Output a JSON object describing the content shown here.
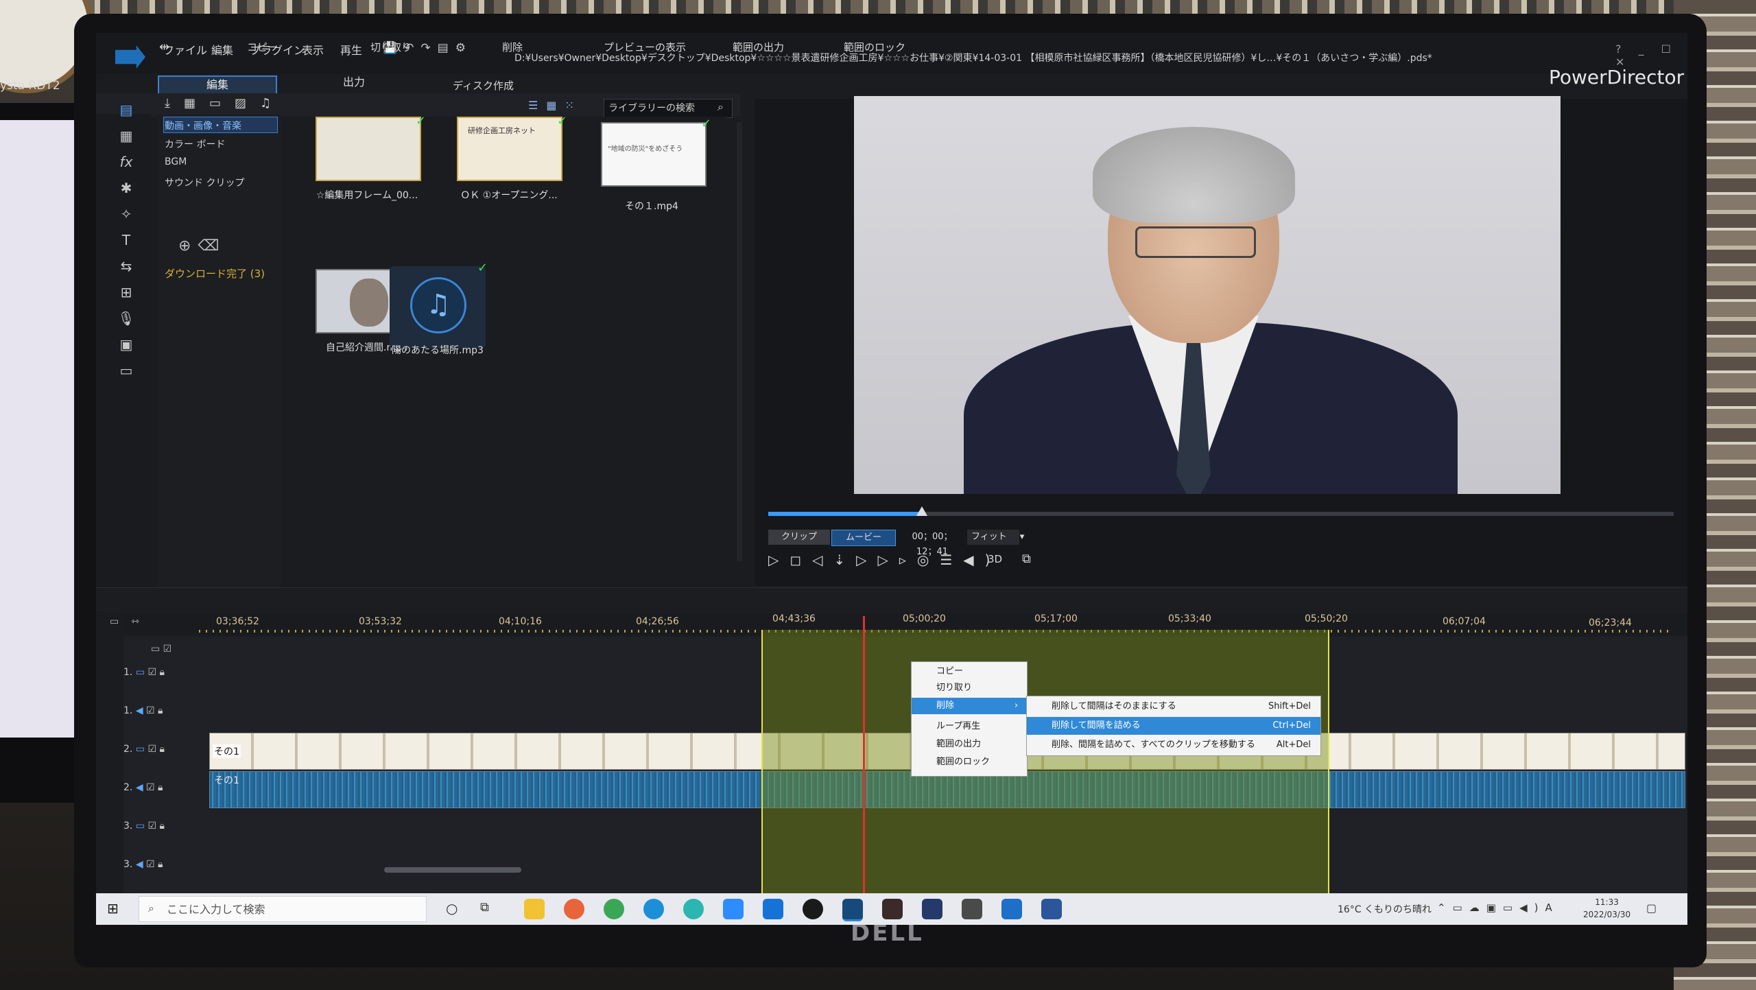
{
  "environment": {
    "left_monitor_brand": "ysta RDT2",
    "monitor_brand": "DELL"
  },
  "app": {
    "name": "PowerDirector",
    "title_path": "D:¥Users¥Owner¥Desktop¥デスクトップ¥Desktop¥☆☆☆☆景表遺研修企画工房¥☆☆☆お仕事¥②関東¥14-03-01 【相模原市社協緑区事務所】（橋本地区民児協研修）¥し…¥その１（あいさつ・学ぶ編）.pds*",
    "menu": [
      "ファイル",
      "編集",
      "プラグイン",
      "表示",
      "再生"
    ],
    "window_buttons": "? _ ☐ ✕"
  },
  "modes": {
    "edit": "編集",
    "output": "出力",
    "disc": "ディスク作成"
  },
  "library": {
    "rooms": [
      "動画・画像・音楽",
      "カラー ボード",
      "BGM",
      "サウンド クリップ"
    ],
    "download_status": "ダウンロード完了 (3)",
    "search_placeholder": "ライブラリーの検索",
    "items": [
      {
        "label": "☆編集用フレーム_00...",
        "caption": ""
      },
      {
        "label": "ＯＫ ①オープニング...",
        "caption": "研修企画工房ネット"
      },
      {
        "label": "その１.mp4",
        "caption": "\"地域の防災\"をめざそう"
      },
      {
        "label": "自己紹介週間.mp4",
        "caption": ""
      },
      {
        "label": "陽のあたる場所.mp3",
        "caption": ""
      }
    ]
  },
  "preview": {
    "clip_tab": "クリップ",
    "movie_tab": "ムービー",
    "timecode": "00；00；12；41",
    "fit": "フィット",
    "mode_3d": "3D",
    "progress": 0.17
  },
  "timeline_toolbar": [
    "コピー",
    "切り取り",
    "削除",
    "プレビューの表示",
    "範囲の出力",
    "範囲のロック"
  ],
  "ruler": [
    "03;36;52",
    "03;53;32",
    "04;10;16",
    "04;26;56",
    "04;43;36",
    "05;00;20",
    "05;17;00",
    "05;33;40",
    "05;50;20",
    "06;07;04",
    "06;23;44"
  ],
  "tracks": [
    {
      "label": "1."
    },
    {
      "label": "1."
    },
    {
      "label": "2."
    },
    {
      "label": "2."
    },
    {
      "label": "3."
    },
    {
      "label": "3."
    }
  ],
  "clips": {
    "video": "その1",
    "audio": "その1"
  },
  "context_menu": {
    "items": [
      "コピー",
      "切り取り",
      "削除",
      "ループ再生",
      "範囲の出力",
      "範囲のロック"
    ],
    "submenu": [
      {
        "label": "削除して間隔はそのままにする",
        "shortcut": "Shift+Del"
      },
      {
        "label": "削除して間隔を詰める",
        "shortcut": "Ctrl+Del"
      },
      {
        "label": "削除、間隔を詰めて、すべてのクリップを移動する",
        "shortcut": "Alt+Del"
      }
    ]
  },
  "taskbar": {
    "search_placeholder": "ここに入力して検索",
    "weather": "16°C くもりのち晴れ",
    "time": "11:33",
    "date": "2022/03/30"
  }
}
